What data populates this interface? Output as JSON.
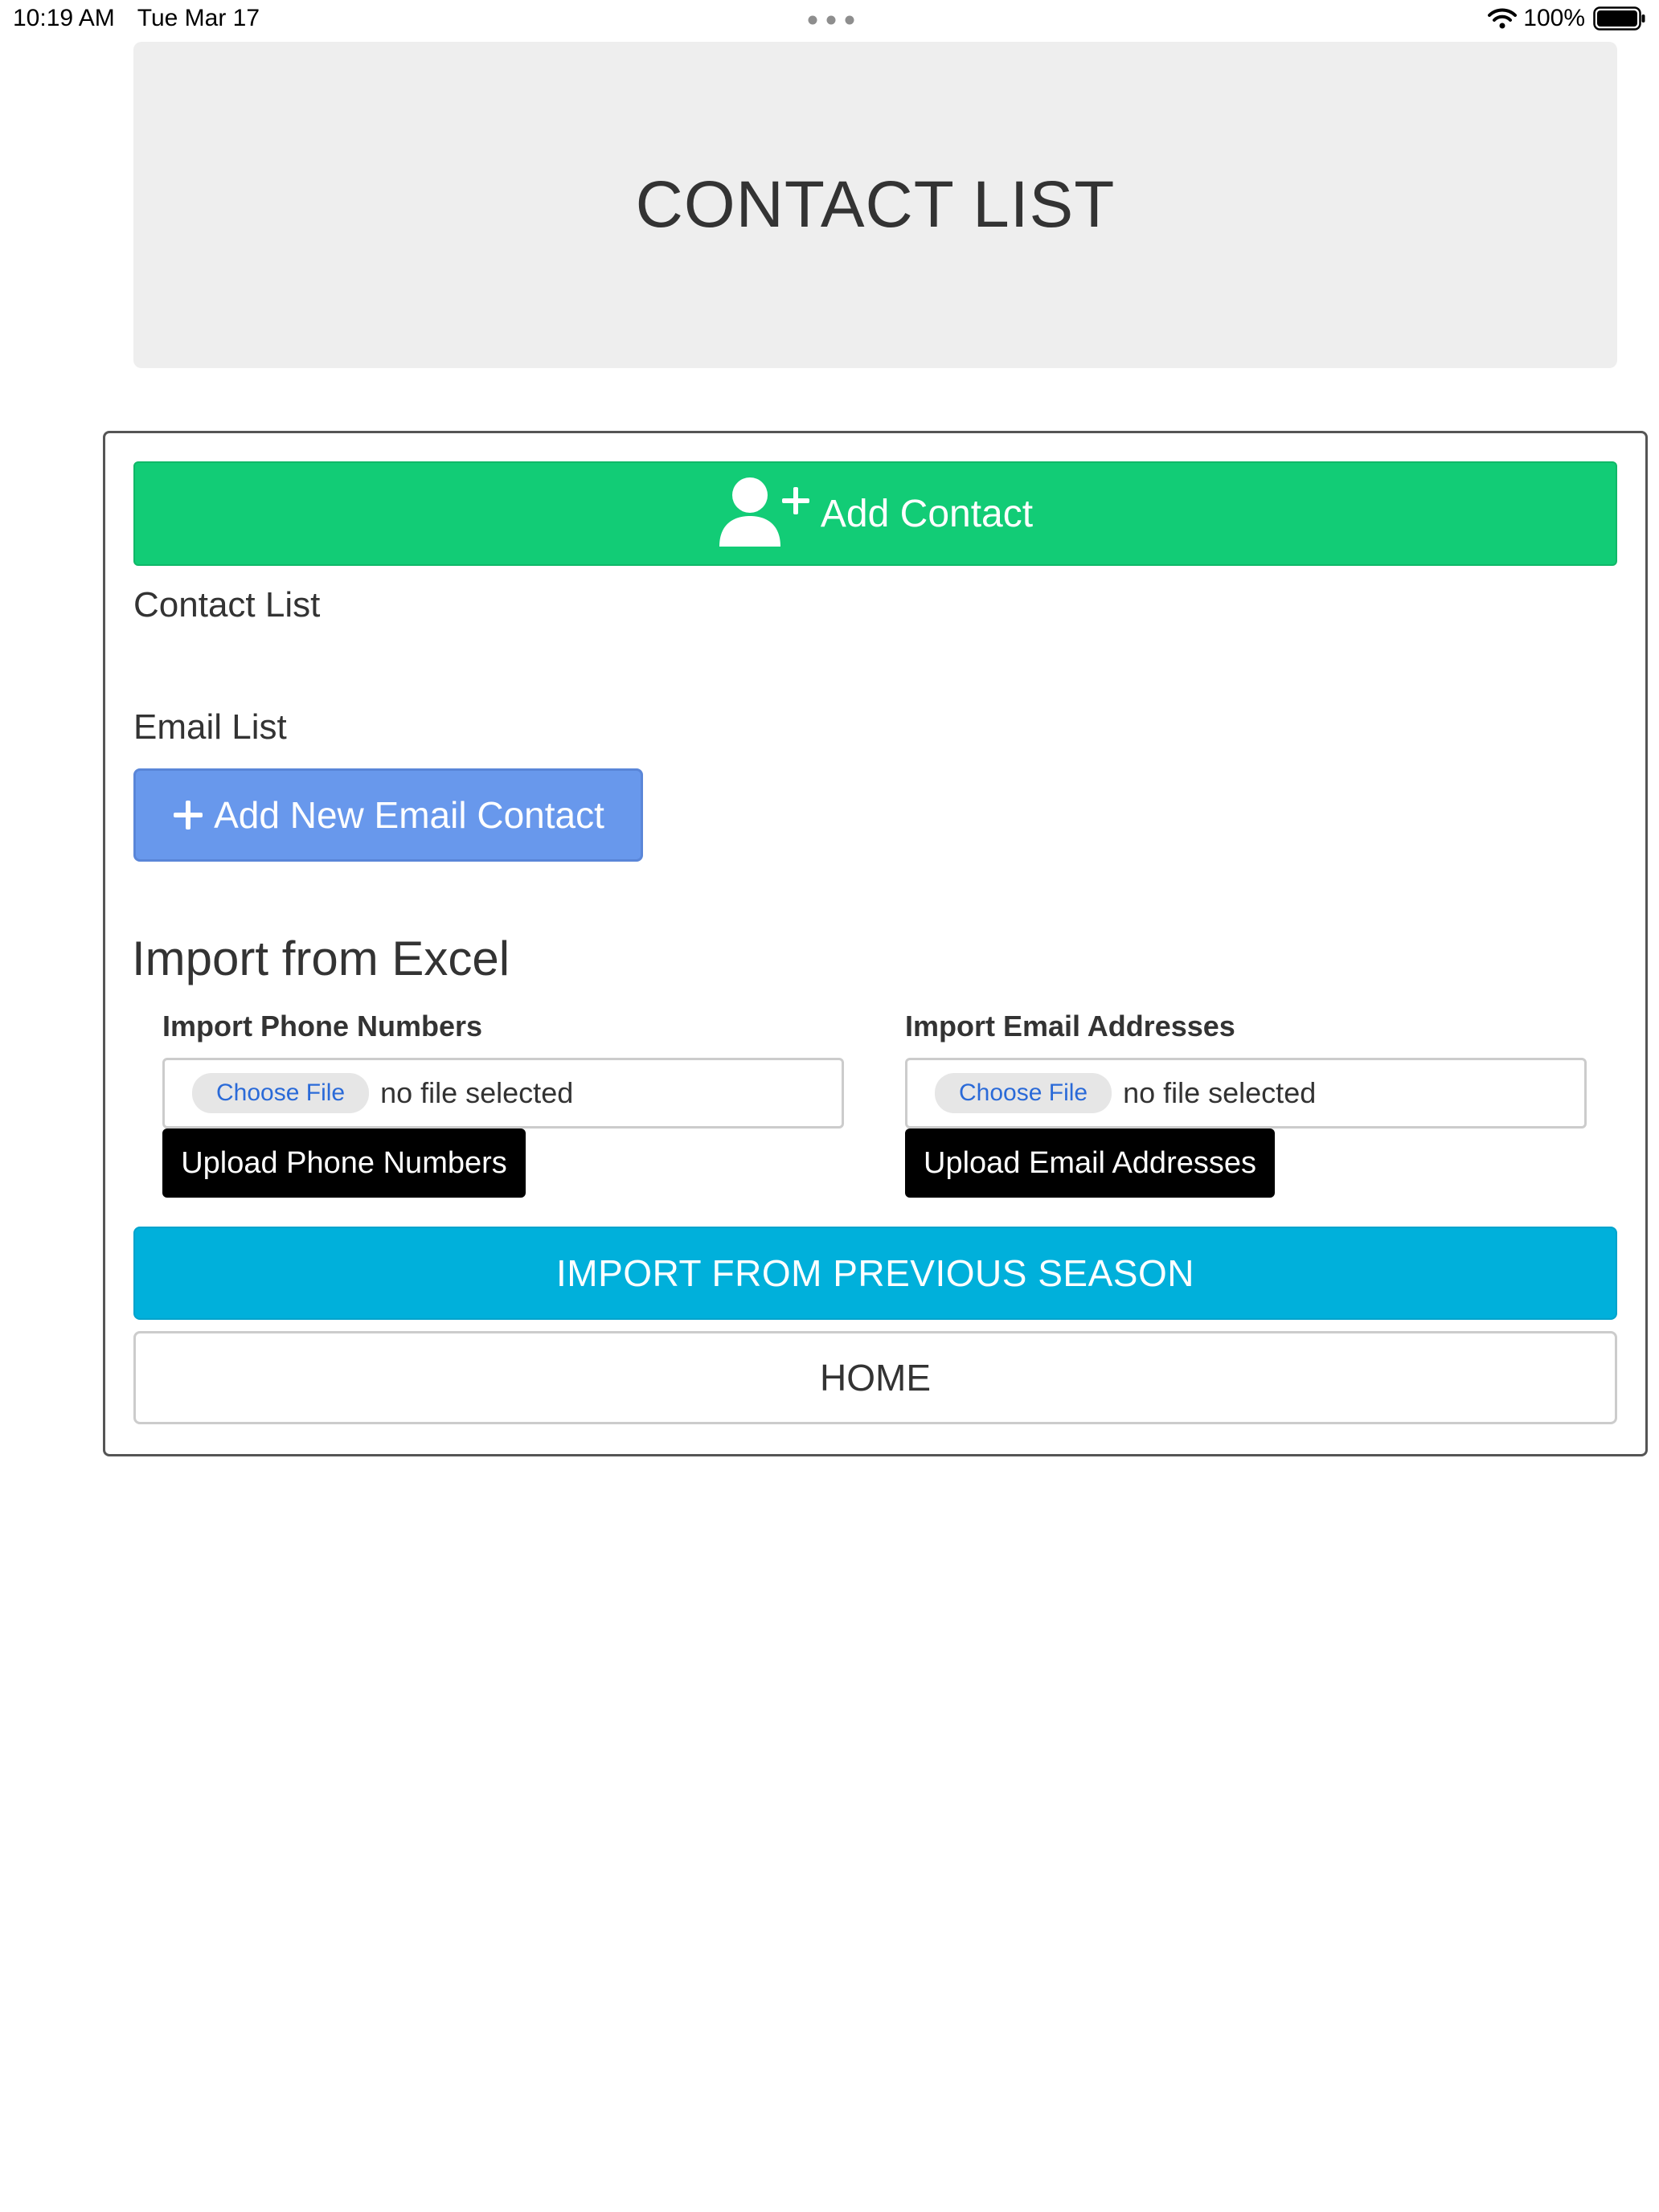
{
  "status_bar": {
    "time": "10:19 AM",
    "date": "Tue Mar 17",
    "battery": "100%"
  },
  "header": {
    "title": "CONTACT LIST"
  },
  "actions": {
    "add_contact_label": "Add Contact",
    "add_email_label": "Add New Email Contact",
    "import_previous_label": "IMPORT FROM PREVIOUS SEASON",
    "home_label": "HOME"
  },
  "sections": {
    "contact_list": "Contact List",
    "email_list": "Email List",
    "import_heading": "Import from Excel"
  },
  "import": {
    "phone": {
      "label": "Import Phone Numbers",
      "choose_label": "Choose File",
      "file_status": "no file selected",
      "upload_label": "Upload Phone Numbers"
    },
    "email": {
      "label": "Import Email Addresses",
      "choose_label": "Choose File",
      "file_status": "no file selected",
      "upload_label": "Upload Email Addresses"
    }
  },
  "colors": {
    "add_contact": "#12cc76",
    "add_email": "#6898ec",
    "import_previous": "#00b0db",
    "upload": "#000000",
    "banner": "#eeeeee"
  },
  "icons": {
    "add_contact": "user-plus-icon",
    "add_email": "plus-icon",
    "wifi": "wifi-icon",
    "battery": "battery-icon",
    "multitask": "multitask-dots-icon"
  }
}
